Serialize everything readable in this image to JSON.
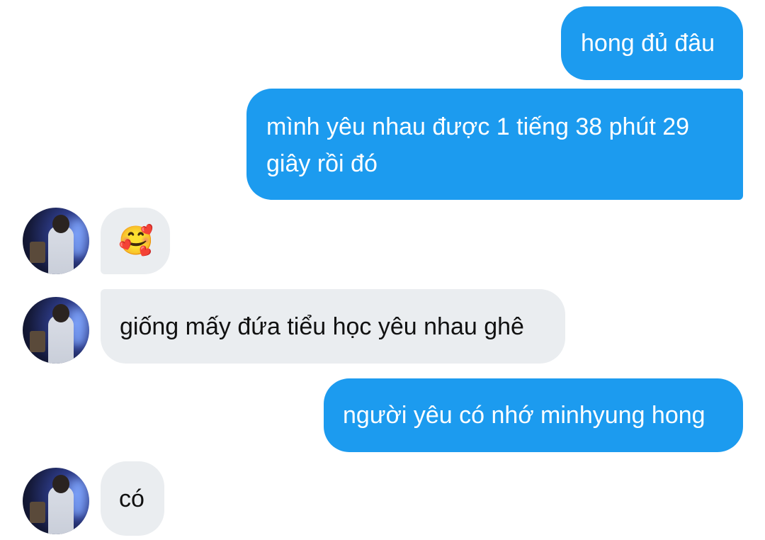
{
  "messages": [
    {
      "id": "m1",
      "direction": "outgoing",
      "text": "hong đủ đâu"
    },
    {
      "id": "m2",
      "direction": "outgoing",
      "line1": "mình yêu nhau được 1 tiếng 38 phút 29",
      "line2": "giây rồi đó"
    },
    {
      "id": "m3",
      "direction": "incoming",
      "emoji": "🥰",
      "emoji_name": "smiling-face-with-hearts"
    },
    {
      "id": "m4",
      "direction": "incoming",
      "text": "giống mấy đứa tiểu học yêu nhau ghê"
    },
    {
      "id": "m5",
      "direction": "outgoing",
      "text": "người yêu có nhớ minhyung hong"
    },
    {
      "id": "m6",
      "direction": "incoming",
      "text": "có"
    }
  ],
  "colors": {
    "outgoing_bubble": "#1c9bef",
    "incoming_bubble": "#eaedf0",
    "outgoing_text": "#ffffff",
    "incoming_text": "#111111"
  }
}
